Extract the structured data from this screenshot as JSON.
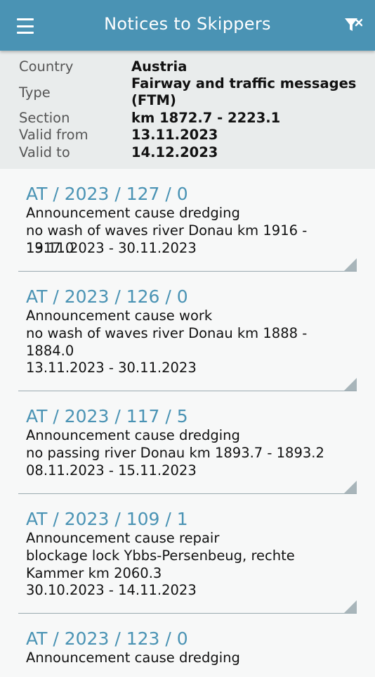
{
  "appbar": {
    "title": "Notices to Skippers",
    "menu_icon": "hamburger-menu-icon",
    "filter_icon": "filter-icon"
  },
  "summary": {
    "country_label": "Country",
    "country_value": "Austria",
    "type_label": "Type",
    "type_value": "Fairway and traffic messages (FTM)",
    "section_label": "Section",
    "section_value": "km 1872.7 - 2223.1",
    "valid_from_label": "Valid from",
    "valid_from_value": "13.11.2023",
    "valid_to_label": "Valid to",
    "valid_to_value": "14.12.2023"
  },
  "notices": [
    {
      "id": "AT / 2023 / 127 / 0",
      "cause": "Announcement cause dredging",
      "detail": "no wash of waves river Donau km 1916 - 1917.0",
      "period": "13.11.2023 - 30.11.2023"
    },
    {
      "id": "AT / 2023 / 126 / 0",
      "cause": "Announcement cause work",
      "detail": "no wash of waves river Donau km 1888 - 1884.0",
      "period": "13.11.2023 - 30.11.2023"
    },
    {
      "id": "AT / 2023 / 117 / 5",
      "cause": "Announcement cause dredging",
      "detail": "no passing river Donau km 1893.7 - 1893.2",
      "period": "08.11.2023 - 15.11.2023"
    },
    {
      "id": "AT / 2023 / 109 / 1",
      "cause": "Announcement cause repair",
      "detail": "blockage lock Ybbs-Persenbeug, rechte Kammer km 2060.3",
      "period": "30.10.2023 - 14.11.2023"
    },
    {
      "id": "AT / 2023 / 123 / 0",
      "cause": "Announcement cause dredging"
    }
  ],
  "colors": {
    "accent": "#4a93b4",
    "summary_bg": "#e9ecec",
    "list_bg": "#f7f8f8"
  }
}
